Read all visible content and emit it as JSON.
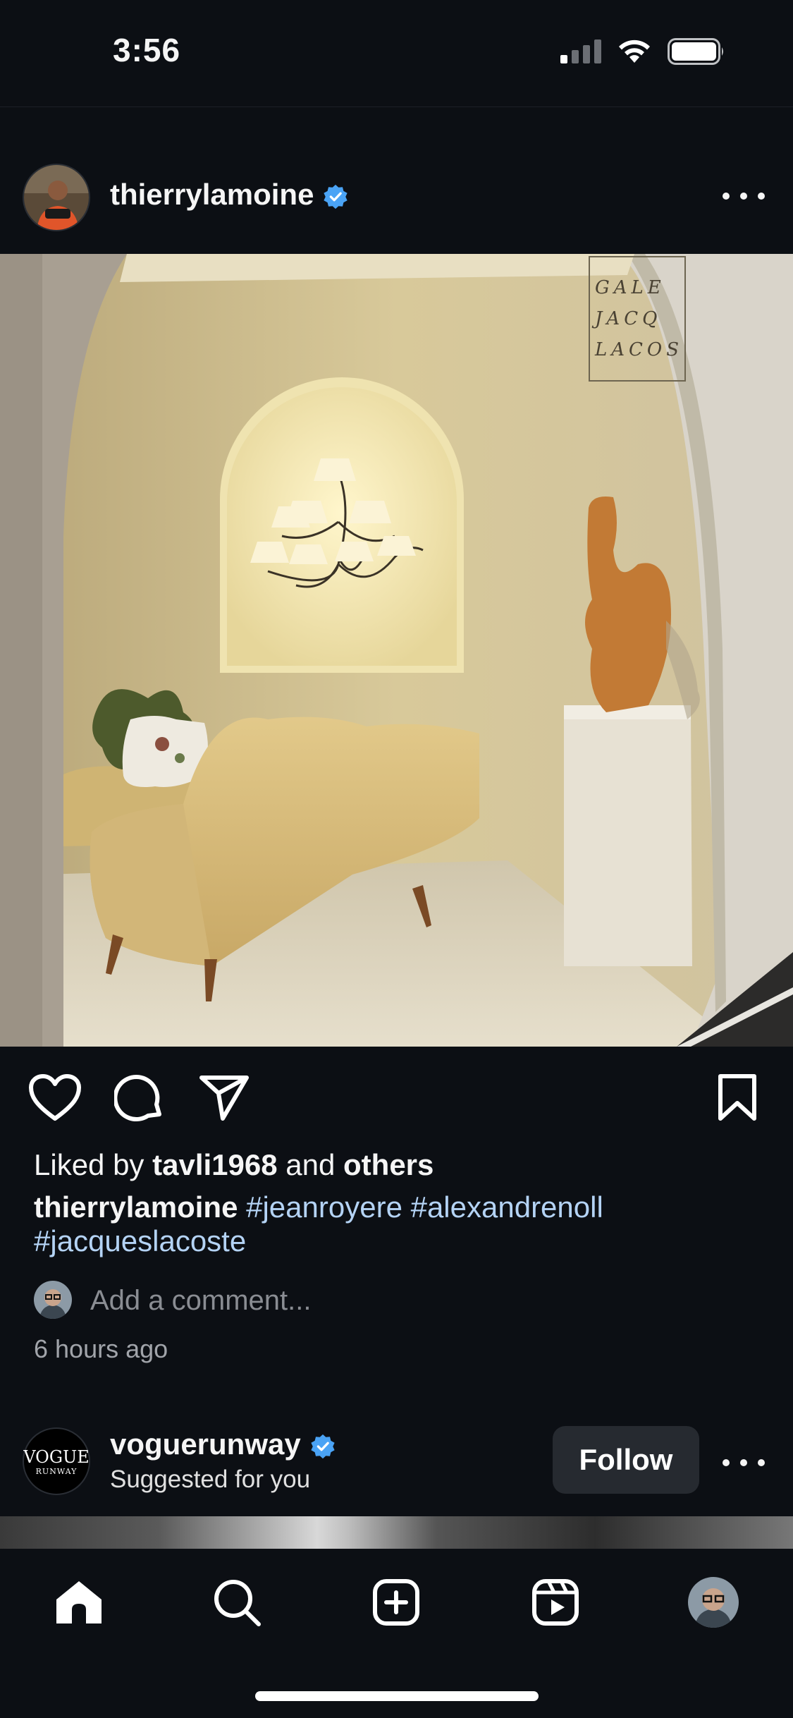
{
  "status_bar": {
    "time": "3:56"
  },
  "post": {
    "username": "thierrylamoine",
    "verified": true,
    "liked_by_prefix": "Liked by ",
    "liked_by_user": "tavli1968",
    "liked_by_mid": " and ",
    "liked_by_others": "others",
    "caption_user": "thierrylamoine",
    "hashtags": [
      "#jeanroyere",
      "#alexandrenoll",
      "#jacqueslacoste"
    ],
    "comment_placeholder": "Add a comment...",
    "timestamp": "6 hours ago",
    "image_sign_lines": [
      "GALE",
      "JACQ",
      "LACOS"
    ]
  },
  "suggested": {
    "username": "voguerunway",
    "verified": true,
    "subtitle": "Suggested for you",
    "follow_label": "Follow",
    "avatar_text": "VOGUE",
    "avatar_subtext": "RUNWAY"
  },
  "tab_bar": {
    "tabs": [
      "home",
      "search",
      "create",
      "reels",
      "profile"
    ],
    "active": "home"
  },
  "colors": {
    "background": "#0c0f14",
    "hashtag": "#b4d3f5",
    "verified": "#4aa3f5",
    "follow_button": "#262a30"
  }
}
